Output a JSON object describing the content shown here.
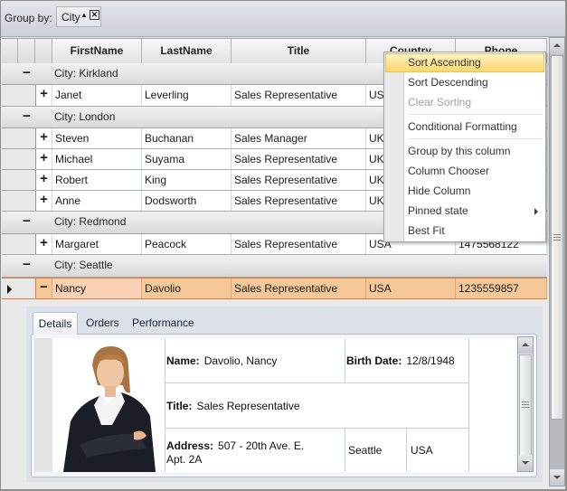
{
  "group_panel": {
    "label": "Group by:",
    "chip": {
      "label": "City",
      "sort_glyph": "▲",
      "close_glyph": "✕"
    }
  },
  "columns": [
    "FirstName",
    "LastName",
    "Title",
    "Country",
    "Phone"
  ],
  "groups": [
    {
      "label": "City: Kirkland",
      "toggle": "−",
      "rows": [
        {
          "expand": "+",
          "first": "Janet",
          "last": "Leverling",
          "title": "Sales Representative",
          "country": "USA",
          "phone": ""
        }
      ]
    },
    {
      "label": "City: London",
      "toggle": "−",
      "rows": [
        {
          "expand": "+",
          "first": "Steven",
          "last": "Buchanan",
          "title": "Sales Manager",
          "country": "UK",
          "phone": ""
        },
        {
          "expand": "+",
          "first": "Michael",
          "last": "Suyama",
          "title": "Sales Representative",
          "country": "UK",
          "phone": ""
        },
        {
          "expand": "+",
          "first": "Robert",
          "last": "King",
          "title": "Sales Representative",
          "country": "UK",
          "phone": ""
        },
        {
          "expand": "+",
          "first": "Anne",
          "last": "Dodsworth",
          "title": "Sales Representative",
          "country": "UK",
          "phone": ""
        }
      ]
    },
    {
      "label": "City: Redmond",
      "toggle": "−",
      "rows": [
        {
          "expand": "+",
          "first": "Margaret",
          "last": "Peacock",
          "title": "Sales Representative",
          "country": "USA",
          "phone": "1475568122"
        }
      ]
    },
    {
      "label": "City: Seattle",
      "toggle": "−",
      "rows": [
        {
          "expand": "−",
          "first": "Nancy",
          "last": "Davolio",
          "title": "Sales Representative",
          "country": "USA",
          "phone": "1235559857",
          "selected": true
        }
      ]
    }
  ],
  "context_menu": {
    "items": [
      {
        "label": "Sort Ascending",
        "state": "highlighted"
      },
      {
        "label": "Sort Descending"
      },
      {
        "label": "Clear Sorting",
        "state": "disabled"
      },
      {
        "label": "Conditional Formatting"
      },
      {
        "label": "Group by this column"
      },
      {
        "label": "Column Chooser"
      },
      {
        "label": "Hide Column"
      },
      {
        "label": "Pinned state",
        "submenu": true
      },
      {
        "label": "Best Fit"
      }
    ]
  },
  "detail": {
    "tabs": [
      "Details",
      "Orders",
      "Performance"
    ],
    "active_tab": "Details",
    "name_label": "Name:",
    "name": "Davolio, Nancy",
    "birth_label": "Birth Date:",
    "birth": "12/8/1948",
    "title_label": "Title:",
    "title": "Sales Representative",
    "address_label": "Address:",
    "address_line1": "507 - 20th Ave. E.",
    "address_line2": "Apt. 2A",
    "city": "Seattle",
    "country": "USA"
  },
  "colors": {
    "selection": "#f6c898",
    "selection_border": "#e07d3f",
    "menu_highlight": "#fbd86d"
  }
}
